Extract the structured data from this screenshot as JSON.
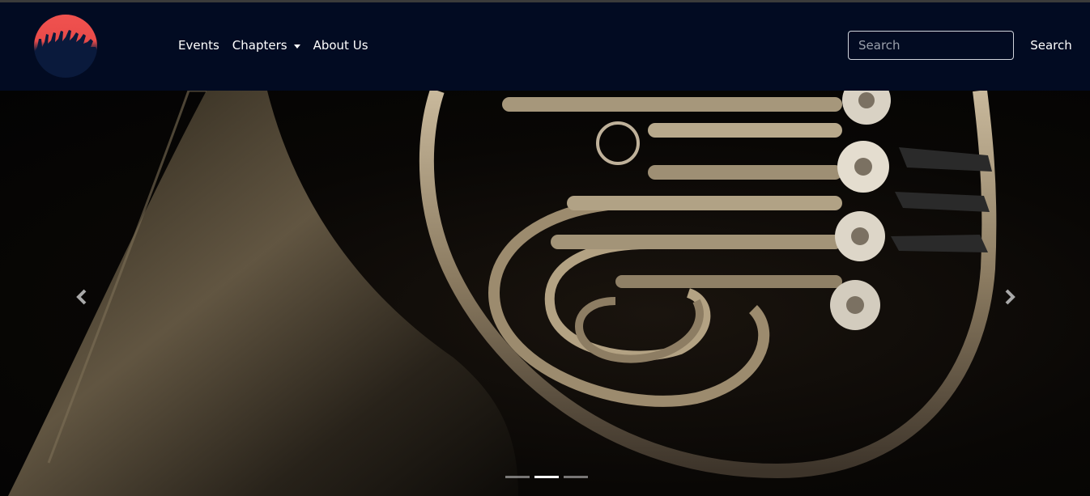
{
  "navbar": {
    "logo_alt": "logo",
    "links": [
      {
        "label": "Events"
      },
      {
        "label": "Chapters"
      },
      {
        "label": "About Us"
      }
    ],
    "search": {
      "placeholder": "Search",
      "value": "",
      "button_label": "Search"
    }
  },
  "carousel": {
    "slide_image": "french-horn-photo",
    "prev_icon": "chevron-left-icon",
    "next_icon": "chevron-right-icon",
    "slide_count": 3,
    "active_index": 1
  },
  "colors": {
    "navbar_bg": "#020b22",
    "logo_top": "#f0524f",
    "logo_bottom": "#071634"
  }
}
